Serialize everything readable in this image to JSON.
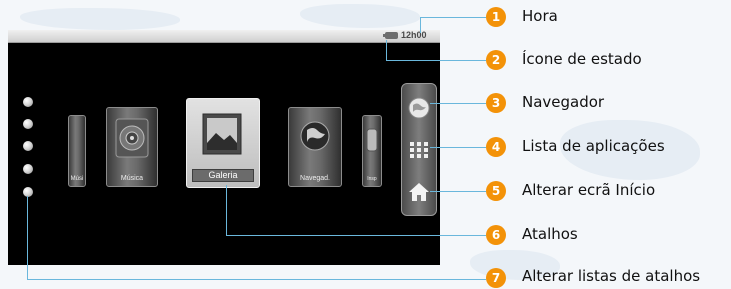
{
  "status_bar": {
    "clock": "12h00",
    "status_icon": "battery-icon"
  },
  "carousel": {
    "cards": [
      {
        "label": "Músi",
        "icon": "music-speaker-icon"
      },
      {
        "label": "Música",
        "icon": "music-speaker-icon"
      },
      {
        "label": "Galeria",
        "icon": "gallery-picture-icon"
      },
      {
        "label": "Navegad.",
        "icon": "globe-icon"
      },
      {
        "label": "Insp",
        "icon": "app-icon"
      }
    ]
  },
  "dock": {
    "buttons": [
      {
        "icon": "browser-globe-icon"
      },
      {
        "icon": "app-grid-icon"
      },
      {
        "icon": "home-icon"
      }
    ]
  },
  "callouts": [
    {
      "number": "1",
      "label": "Hora"
    },
    {
      "number": "2",
      "label": "Ícone de estado"
    },
    {
      "number": "3",
      "label": "Navegador"
    },
    {
      "number": "4",
      "label": "Lista de aplicações"
    },
    {
      "number": "5",
      "label": "Alterar ecrã Início"
    },
    {
      "number": "6",
      "label": "Atalhos"
    },
    {
      "number": "7",
      "label": "Alterar listas de atalhos"
    }
  ],
  "colors": {
    "badge": "#f39208",
    "leader_line": "#6ab7dc",
    "screen": "#000000"
  }
}
